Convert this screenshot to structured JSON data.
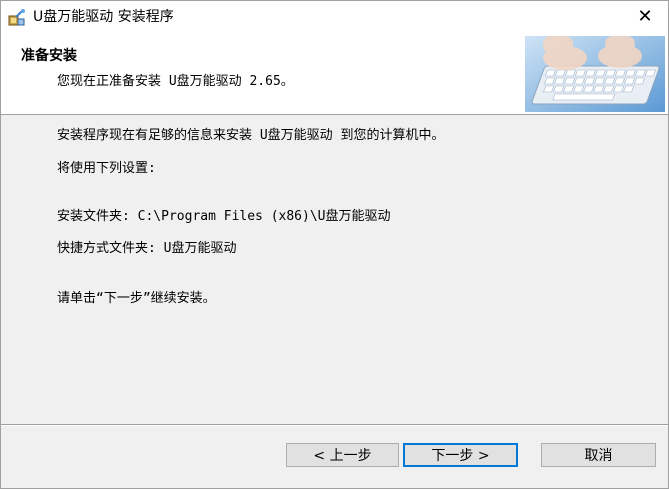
{
  "window": {
    "title": "U盘万能驱动 安装程序",
    "close_glyph": "✕"
  },
  "header": {
    "title": "准备安装",
    "subtitle": "您现在正准备安装 U盘万能驱动 2.65。",
    "image_icon": "keyboard-hands-image"
  },
  "body": {
    "line1": "安装程序现在有足够的信息来安装 U盘万能驱动 到您的计算机中。",
    "line2": "将使用下列设置:",
    "install_folder": "安装文件夹: C:\\Program Files (x86)\\U盘万能驱动",
    "shortcut_folder": "快捷方式文件夹: U盘万能驱动",
    "instruction": "请单击“下一步”继续安装。"
  },
  "buttons": {
    "back": "< 上一步",
    "next": "下一步 >",
    "cancel": "取消"
  },
  "colors": {
    "accent": "#0078d7",
    "dialog_bg": "#f0f0f0"
  }
}
